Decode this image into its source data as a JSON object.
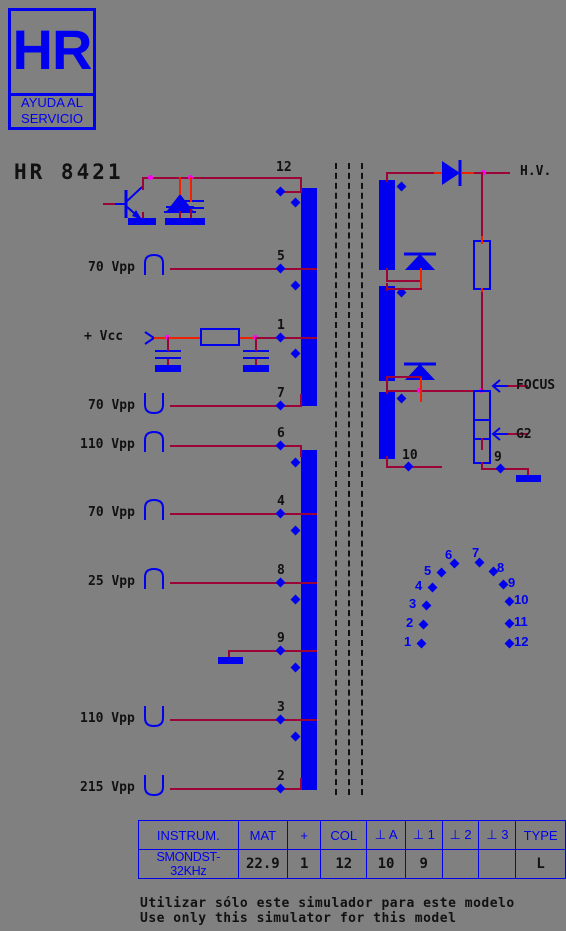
{
  "logo": {
    "mark": "HR",
    "line1": "AYUDA AL",
    "line2": "SERVICIO"
  },
  "title": "HR 8421",
  "schematic": {
    "primary_rows": [
      {
        "label": "",
        "pin": "12",
        "waveform": "none"
      },
      {
        "label": "70 Vpp",
        "pin": "5",
        "waveform": "hump"
      },
      {
        "label": "+ Vcc",
        "pin": "1",
        "waveform": "none"
      },
      {
        "label": "70 Vpp",
        "pin": "7",
        "waveform": "u"
      },
      {
        "label": "110 Vpp",
        "pin": "6",
        "waveform": "hump"
      },
      {
        "label": "70 Vpp",
        "pin": "4",
        "waveform": "hump"
      },
      {
        "label": "25 Vpp",
        "pin": "8",
        "waveform": "hump"
      },
      {
        "label": "",
        "pin": "9",
        "waveform": "none"
      },
      {
        "label": "110 Vpp",
        "pin": "3",
        "waveform": "u"
      },
      {
        "label": "215 Vpp",
        "pin": "2",
        "waveform": "u"
      }
    ],
    "secondary_labels": {
      "hv": "H.V.",
      "focus": "FOCUS",
      "g2": "G2",
      "pin10": "10",
      "pin9": "9"
    }
  },
  "pinout": {
    "pins": [
      "1",
      "2",
      "3",
      "4",
      "5",
      "6",
      "7",
      "8",
      "9",
      "10",
      "11",
      "12"
    ]
  },
  "table": {
    "headers": [
      "INSTRUM.",
      "MAT",
      "+",
      "COL",
      "⊥ A",
      "⊥ 1",
      "⊥ 2",
      "⊥ 3",
      "TYPE"
    ],
    "row": [
      "SMONDST-32KHz",
      "22.9",
      "1",
      "12",
      "10",
      "9",
      "",
      "",
      "L"
    ]
  },
  "footer": {
    "spanish": "Utilizar sólo este simulador para este modelo",
    "english": "Use only this simulator for this model"
  },
  "colors": {
    "background": "#808080",
    "brand_blue": "#0000ee",
    "wire": "#9b0438",
    "wire_red": "#ee2200",
    "junction": "#ff00ff",
    "text": "#111111"
  }
}
